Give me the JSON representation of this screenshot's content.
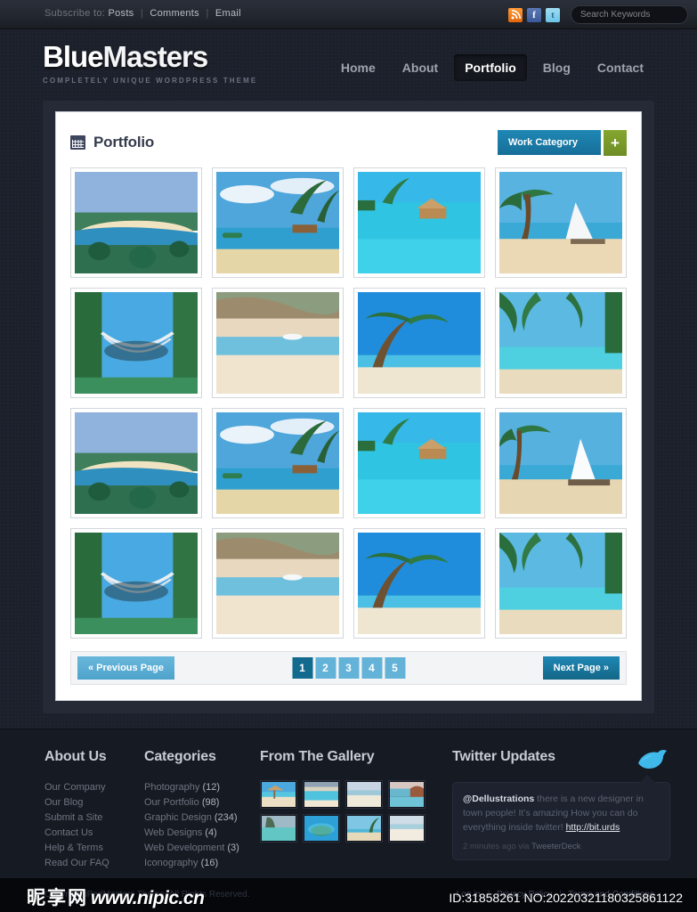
{
  "topbar": {
    "subscribe_label": "Subscribe to:",
    "links": [
      "Posts",
      "Comments",
      "Email"
    ],
    "social": [
      {
        "name": "rss-icon",
        "glyph": "◔"
      },
      {
        "name": "facebook-icon",
        "glyph": "f"
      },
      {
        "name": "twitter-icon",
        "glyph": "t"
      }
    ],
    "search_placeholder": "Search Keywords",
    "search_value": ""
  },
  "header": {
    "logo_first": "Blue",
    "logo_second": "Masters",
    "tagline": "COMPLETELY UNIQUE WORDPRESS THEME",
    "nav": [
      {
        "label": "Home",
        "active": false
      },
      {
        "label": "About",
        "active": false
      },
      {
        "label": "Portfolio",
        "active": true
      },
      {
        "label": "Blog",
        "active": false
      },
      {
        "label": "Contact",
        "active": false
      }
    ]
  },
  "portfolio": {
    "title": "Portfolio",
    "category_button": "Work Category",
    "add_button": "+",
    "items": [
      {
        "alt": "Beach bay with palm trees and blue sea"
      },
      {
        "alt": "Palm trees over lagoon with huts"
      },
      {
        "alt": "Overwater bungalows turquoise sea"
      },
      {
        "alt": "Sailboat on white sand beach with palm"
      },
      {
        "alt": "Hammock between palm trees on beach"
      },
      {
        "alt": "Pink sand cove with boat"
      },
      {
        "alt": "Leaning palm tree over white beach"
      },
      {
        "alt": "Palm fronds over turquoise water"
      },
      {
        "alt": "Beach bay with palm trees and blue sea"
      },
      {
        "alt": "Palm trees over lagoon with huts"
      },
      {
        "alt": "Overwater bungalows turquoise sea"
      },
      {
        "alt": "Catamaran on beach with palms"
      },
      {
        "alt": "Hammock between palm trees on beach"
      },
      {
        "alt": "Pink sand cove with boat"
      },
      {
        "alt": "Leaning palm tree over white beach"
      },
      {
        "alt": "Palm fronds over turquoise water"
      }
    ],
    "pagination": {
      "previous": "« Previous Page",
      "next": "Next Page »",
      "pages": [
        "1",
        "2",
        "3",
        "4",
        "5"
      ],
      "active_page": "1"
    }
  },
  "footer": {
    "about": {
      "heading": "About Us",
      "links": [
        "Our Company",
        "Our Blog",
        "Submit a Site",
        "Contact Us",
        "Help & Terms",
        "Read Our FAQ"
      ]
    },
    "categories": {
      "heading": "Categories",
      "items": [
        {
          "label": "Photography",
          "count": "(12)"
        },
        {
          "label": "Our Portfolio",
          "count": "(98)"
        },
        {
          "label": "Graphic Design",
          "count": "(234)"
        },
        {
          "label": "Web Designs",
          "count": "(4)"
        },
        {
          "label": "Web Development",
          "count": "(3)"
        },
        {
          "label": "Iconography",
          "count": "(16)"
        }
      ]
    },
    "gallery": {
      "heading": "From The Gallery",
      "thumbs": [
        {
          "alt": "Beach umbrella on white sand"
        },
        {
          "alt": "Coastal town beach aerial"
        },
        {
          "alt": "Wide empty white beach"
        },
        {
          "alt": "Rocky red cliff beach"
        },
        {
          "alt": "Limestone cliff over green water"
        },
        {
          "alt": "Tropical island aerial"
        },
        {
          "alt": "Palm tree over calm beach"
        },
        {
          "alt": "Pale sandy shoreline"
        }
      ]
    },
    "twitter": {
      "heading": "Twitter Updates",
      "user": "@Dellustrations",
      "text": " there is a new designer in town people! It’s amazing How you can do everything inside twitter! ",
      "link": "http://bit.urds",
      "meta_time": "2 minutes ago via ",
      "meta_client": "TweeterDeck"
    }
  },
  "bottombar": {
    "copyright": "Copyright iPadMasters Theme. All Rights Reserved.",
    "links": [
      "Log in",
      "Privacy Policy",
      "Terms and Conditions"
    ]
  },
  "watermark": {
    "zh": "昵享网",
    "site": "www.nipic.cn",
    "id": "ID:31858261 NO:20220321180325861122"
  },
  "colors": {
    "accent_blue": "#1f87b5",
    "light_blue": "#63b2d8",
    "green": "#84a62f",
    "page_bg": "#1c202b",
    "footer_bg": "#161a23"
  }
}
